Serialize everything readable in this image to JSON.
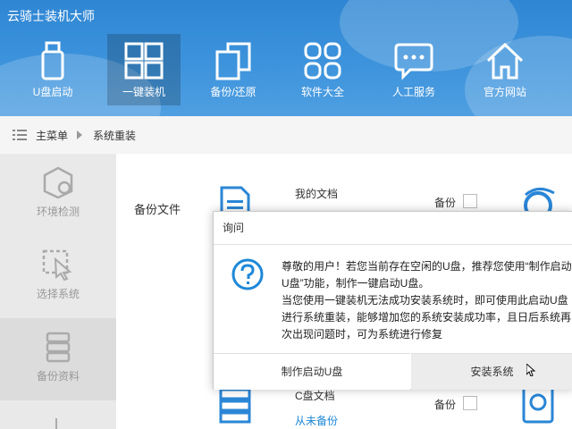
{
  "app": {
    "title": "云骑士装机大师"
  },
  "nav": [
    {
      "label": "U盘启动",
      "icon": "usb-icon"
    },
    {
      "label": "一键装机",
      "icon": "windows-icon"
    },
    {
      "label": "备份/还原",
      "icon": "backup-restore-icon"
    },
    {
      "label": "软件大全",
      "icon": "apps-grid-icon"
    },
    {
      "label": "人工服务",
      "icon": "chat-icon"
    },
    {
      "label": "官方网站",
      "icon": "home-icon"
    }
  ],
  "breadcrumb": {
    "root": "主菜单",
    "current": "系统重装"
  },
  "sidebar": [
    {
      "label": "环境检测",
      "icon": "environment-check-icon"
    },
    {
      "label": "选择系统",
      "icon": "cursor-select-icon"
    },
    {
      "label": "备份资料",
      "icon": "database-icon"
    }
  ],
  "content": {
    "backup_section": "备份文件",
    "my_docs": "我的文档",
    "backup_label_1": "备份",
    "c_disk": "C盘文档",
    "never_backup": "从未备份",
    "backup_label_2": "备份"
  },
  "dialog": {
    "title": "询问",
    "lines": [
      "尊敬的用户！若您当前存在空闲的U盘，推荐您使用“制作启动",
      "U盘”功能，制作一键启动U盘。",
      "当您使用一键装机无法成功安装系统时，即可使用此启动U盘",
      "进行系统重装，能够增加您的系统安装成功率，且日后系统再",
      "次出现问题时，可为系统进行修复"
    ],
    "make_usb_button": "制作启动U盘",
    "install_button": "安装系统"
  },
  "colors": {
    "header_blue": "#3a8fda",
    "accent": "#1e88d8",
    "link": "#1e88d8"
  }
}
